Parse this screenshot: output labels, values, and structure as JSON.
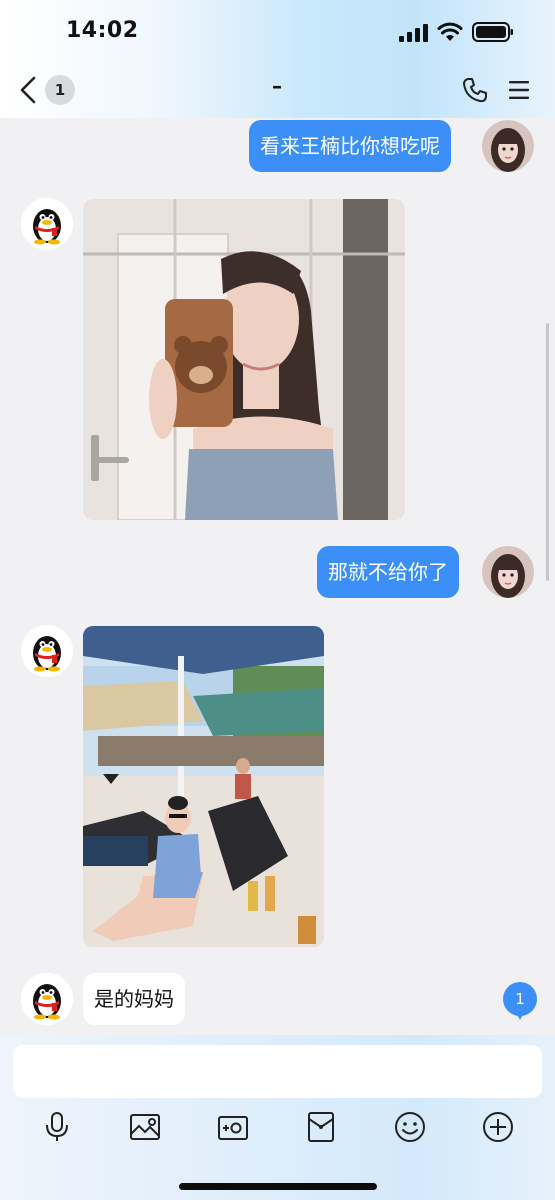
{
  "status_bar": {
    "time": "14:02"
  },
  "header": {
    "back_count": "1",
    "title": "–"
  },
  "messages": [
    {
      "direction": "outgoing",
      "type": "text",
      "text": "看来王楠比你想吃呢"
    },
    {
      "direction": "incoming",
      "type": "image",
      "image": "mirror-selfie-photo"
    },
    {
      "direction": "outgoing",
      "type": "text",
      "text": "那就不给你了"
    },
    {
      "direction": "incoming",
      "type": "image",
      "image": "poolside-photo"
    },
    {
      "direction": "incoming",
      "type": "text",
      "text": "是的妈妈"
    }
  ],
  "new_message_badge": "1",
  "composer": {
    "placeholder": ""
  },
  "toolbar": [
    "microphone-icon",
    "photo-icon",
    "camera-icon",
    "red-packet-icon",
    "emoji-icon",
    "add-icon"
  ],
  "colors": {
    "outgoing_bubble": "#3b8ff6",
    "incoming_bubble": "#ffffff",
    "background": "#f1f1f3"
  }
}
